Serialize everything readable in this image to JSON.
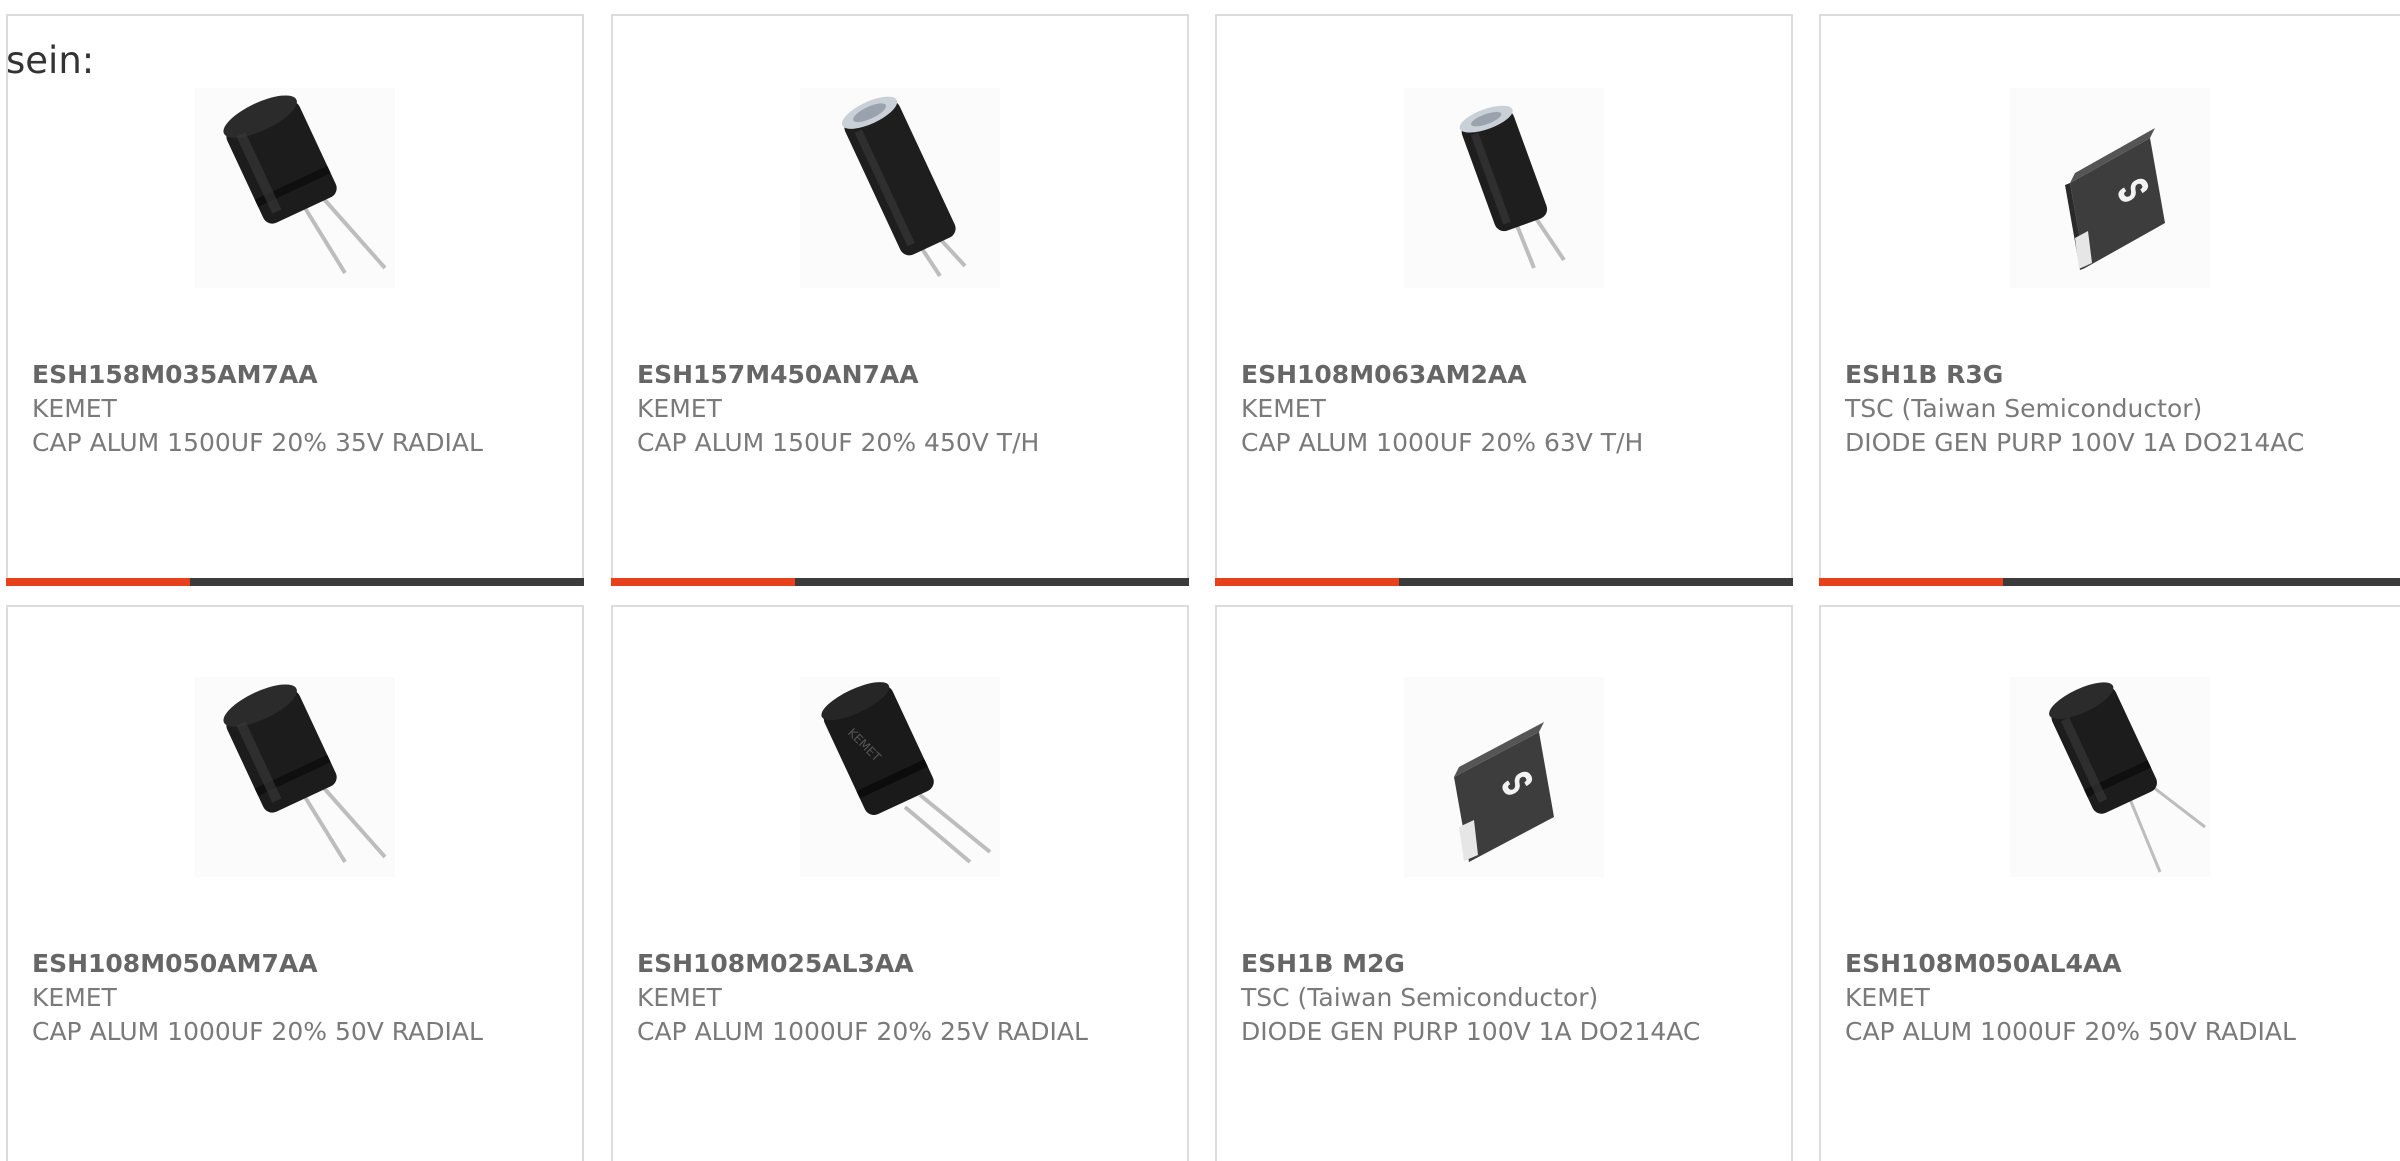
{
  "intro_text": "sein:",
  "colors": {
    "accent": "#e8401c",
    "bar_dark": "#3b3b3b",
    "card_border": "#dcdcdc",
    "text_muted": "#7a7a7a"
  },
  "cards": [
    {
      "part_number": "ESH158M035AM7AA",
      "manufacturer": "KEMET",
      "description": "CAP ALUM 1500UF 20% 35V RADIAL",
      "image_icon": "radial-capacitor-icon"
    },
    {
      "part_number": "ESH157M450AN7AA",
      "manufacturer": "KEMET",
      "description": "CAP ALUM 150UF 20% 450V T/H",
      "image_icon": "tall-capacitor-icon"
    },
    {
      "part_number": "ESH108M063AM2AA",
      "manufacturer": "KEMET",
      "description": "CAP ALUM 1000UF 20% 63V T/H",
      "image_icon": "tall-capacitor-icon"
    },
    {
      "part_number": "ESH1B R3G",
      "manufacturer": "TSC (Taiwan Semiconductor)",
      "description": "DIODE GEN PURP 100V 1A DO214AC",
      "image_icon": "smd-diode-icon"
    },
    {
      "part_number": "ESH108M050AM7AA",
      "manufacturer": "KEMET",
      "description": "CAP ALUM 1000UF 20% 50V RADIAL",
      "image_icon": "radial-capacitor-icon"
    },
    {
      "part_number": "ESH108M025AL3AA",
      "manufacturer": "KEMET",
      "description": "CAP ALUM 1000UF 20% 25V RADIAL",
      "image_icon": "kemet-capacitor-icon"
    },
    {
      "part_number": "ESH1B M2G",
      "manufacturer": "TSC (Taiwan Semiconductor)",
      "description": "DIODE GEN PURP 100V 1A DO214AC",
      "image_icon": "smd-diode-icon"
    },
    {
      "part_number": "ESH108M050AL4AA",
      "manufacturer": "KEMET",
      "description": "CAP ALUM 1000UF 20% 50V RADIAL",
      "image_icon": "radial-capacitor-icon"
    }
  ]
}
